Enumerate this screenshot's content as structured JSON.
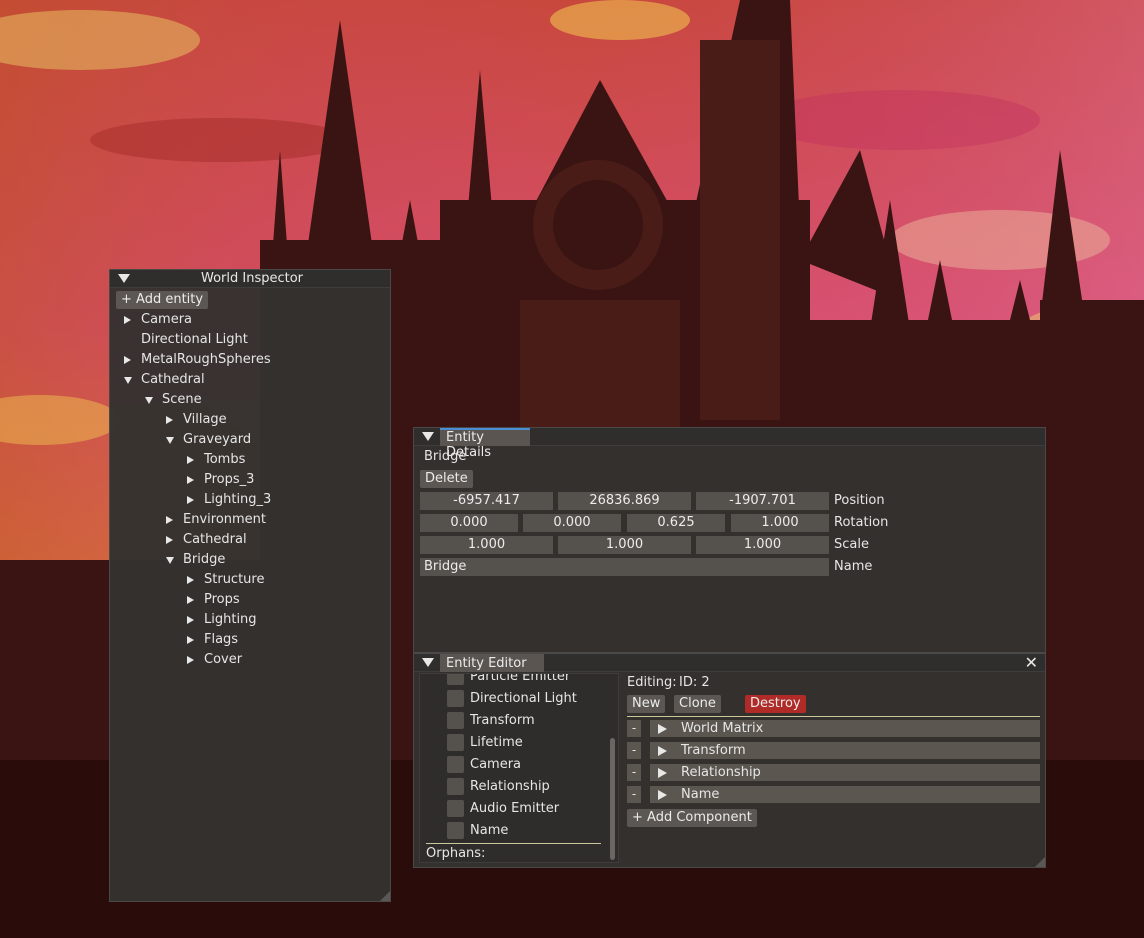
{
  "world_inspector": {
    "title": "World Inspector",
    "add_entity_label": "+ Add entity",
    "tree": [
      {
        "label": "Camera",
        "depth": 0,
        "arrow": "right"
      },
      {
        "label": "Directional Light",
        "depth": 0,
        "arrow": "none"
      },
      {
        "label": "MetalRoughSpheres",
        "depth": 0,
        "arrow": "right"
      },
      {
        "label": "Cathedral",
        "depth": 0,
        "arrow": "down"
      },
      {
        "label": "Scene",
        "depth": 1,
        "arrow": "down"
      },
      {
        "label": "Village",
        "depth": 2,
        "arrow": "right"
      },
      {
        "label": "Graveyard",
        "depth": 2,
        "arrow": "down"
      },
      {
        "label": "Tombs",
        "depth": 3,
        "arrow": "right"
      },
      {
        "label": "Props_3",
        "depth": 3,
        "arrow": "right"
      },
      {
        "label": "Lighting_3",
        "depth": 3,
        "arrow": "right"
      },
      {
        "label": "Environment",
        "depth": 2,
        "arrow": "right"
      },
      {
        "label": "Cathedral",
        "depth": 2,
        "arrow": "right"
      },
      {
        "label": "Bridge",
        "depth": 2,
        "arrow": "down"
      },
      {
        "label": "Structure",
        "depth": 3,
        "arrow": "right"
      },
      {
        "label": "Props",
        "depth": 3,
        "arrow": "right"
      },
      {
        "label": "Lighting",
        "depth": 3,
        "arrow": "right"
      },
      {
        "label": "Flags",
        "depth": 3,
        "arrow": "right"
      },
      {
        "label": "Cover",
        "depth": 3,
        "arrow": "right"
      }
    ]
  },
  "entity_details": {
    "tab_label": "Entity Details",
    "entity_name": "Bridge",
    "delete_label": "Delete",
    "position": {
      "label": "Position",
      "values": [
        "-6957.417",
        "26836.869",
        "-1907.701"
      ]
    },
    "rotation": {
      "label": "Rotation",
      "values": [
        "0.000",
        "0.000",
        "0.625",
        "1.000"
      ]
    },
    "scale": {
      "label": "Scale",
      "values": [
        "1.000",
        "1.000",
        "1.000"
      ]
    },
    "name": {
      "label": "Name",
      "value": "Bridge"
    }
  },
  "entity_editor": {
    "tab_label": "Entity Editor",
    "close_icon": "close-icon",
    "component_filters": [
      "Particle Emitter",
      "Directional Light",
      "Transform",
      "Lifetime",
      "Camera",
      "Relationship",
      "Audio Emitter",
      "Name"
    ],
    "orphans_label": "Orphans:",
    "editing_label": "Editing:",
    "editing_id": "ID: 2",
    "new_label": "New",
    "clone_label": "Clone",
    "destroy_label": "Destroy",
    "components": [
      "World Matrix",
      "Transform",
      "Relationship",
      "Name"
    ],
    "remove_label": "-",
    "add_component_label": "+ Add Component"
  },
  "colors": {
    "accent": "#4a8fd6",
    "destroy": "#b02a27",
    "separator": "#c8c89a"
  }
}
